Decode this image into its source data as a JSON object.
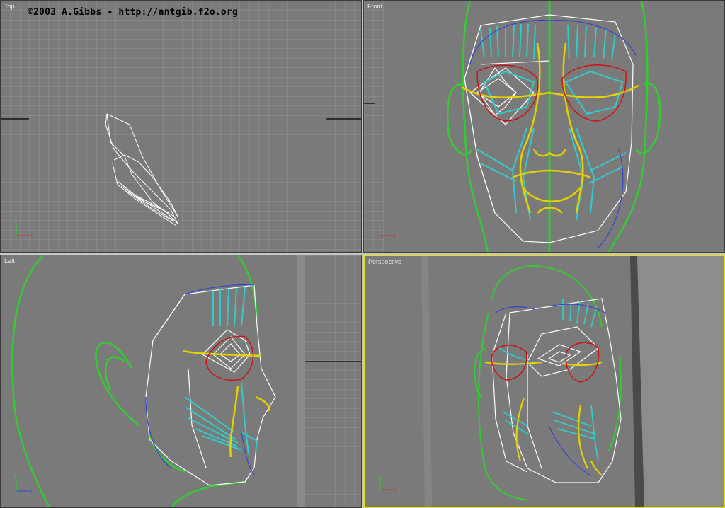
{
  "copyright": "©2003 A.Gibbs - http://antgib.f2o.org",
  "viewports": {
    "top": {
      "label": "Top",
      "axes": {
        "up": "y",
        "right": "x"
      }
    },
    "front": {
      "label": "Front",
      "axes": {
        "up": "z",
        "right": "x"
      }
    },
    "left": {
      "label": "Left",
      "axes": {
        "up": "z",
        "right": "y"
      }
    },
    "perspective": {
      "label": "Perspective",
      "axes": {
        "up": "z",
        "right": "x"
      },
      "active": true
    }
  },
  "colors": {
    "viewport_bg": "#7a7a7a",
    "grid": "#9a9a9a",
    "head_outline": "#33cc33",
    "wire_white": "#ffffff",
    "muscle_cyan": "#33cccc",
    "muscle_yellow": "#e6d200",
    "eye_red": "#cc1111",
    "blue_line": "#3344cc",
    "active_border": "#e8e000"
  }
}
